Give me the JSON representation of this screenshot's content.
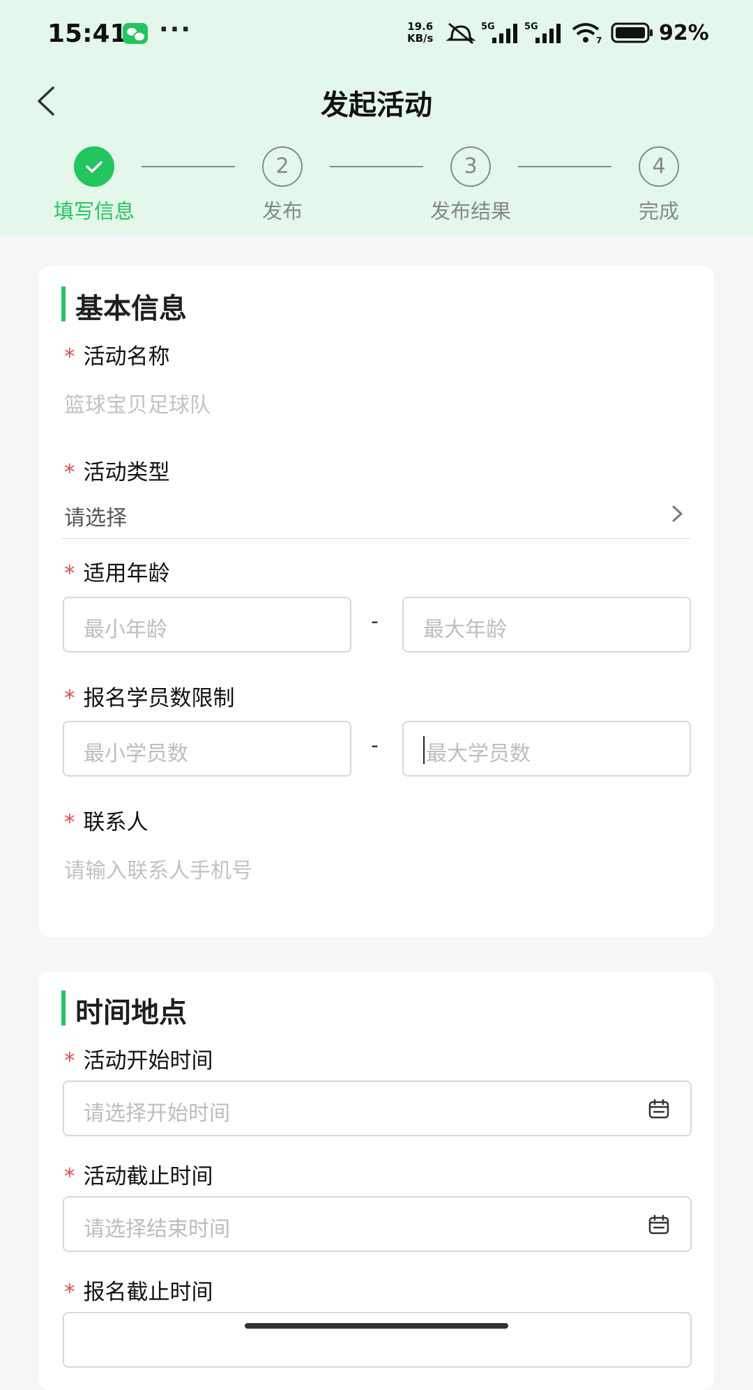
{
  "status_bar": {
    "time": "15:41",
    "net_speed_value": "19.6",
    "net_speed_unit": "KB/s",
    "signal1_label": "5G",
    "signal2_label": "5G",
    "wifi_badge": "7",
    "battery": "92%"
  },
  "nav": {
    "title": "发起活动"
  },
  "steps": [
    {
      "num": "1",
      "label": "填写信息",
      "status": "done"
    },
    {
      "num": "2",
      "label": "发布",
      "status": "pending"
    },
    {
      "num": "3",
      "label": "发布结果",
      "status": "pending"
    },
    {
      "num": "4",
      "label": "完成",
      "status": "pending"
    }
  ],
  "basic_info": {
    "title": "基本信息",
    "activity_name": {
      "label": "活动名称",
      "placeholder": "篮球宝贝足球队"
    },
    "activity_type": {
      "label": "活动类型",
      "value": "请选择"
    },
    "age": {
      "label": "适用年龄",
      "min_placeholder": "最小年龄",
      "max_placeholder": "最大年龄",
      "separator": "-"
    },
    "students": {
      "label": "报名学员数限制",
      "min_placeholder": "最小学员数",
      "max_placeholder": "最大学员数",
      "separator": "-"
    },
    "contact": {
      "label": "联系人",
      "placeholder": "请输入联系人手机号"
    }
  },
  "time_place": {
    "title": "时间地点",
    "start": {
      "label": "活动开始时间",
      "placeholder": "请选择开始时间"
    },
    "end": {
      "label": "活动截止时间",
      "placeholder": "请选择结束时间"
    },
    "signup_deadline": {
      "label": "报名截止时间"
    }
  },
  "required_mark": "*",
  "colors": {
    "accent": "#22c55e",
    "header_bg": "#e3f8ea",
    "required": "#e14c4c"
  }
}
